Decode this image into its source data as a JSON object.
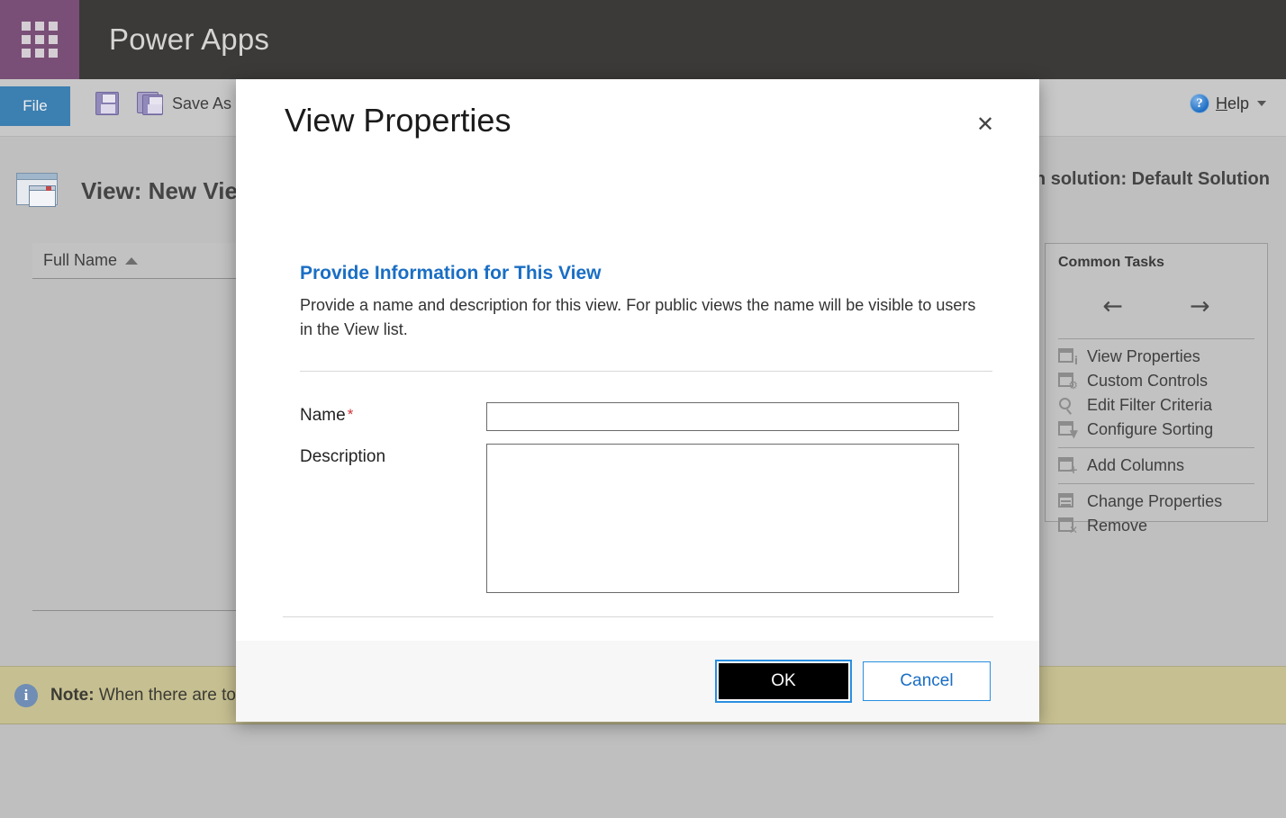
{
  "app_bar": {
    "waffle_icon": "app-launcher-waffle-icon",
    "title": "Power Apps"
  },
  "ribbon": {
    "file_tab": "File",
    "save_icon": "save-floppy-icon",
    "save_as_icon": "save-as-floppy-icon",
    "save_as_label": "Save As",
    "help": {
      "icon": "help-question-icon",
      "accesskey": "H",
      "label_rest": "elp",
      "caret": "chevron-down-icon"
    }
  },
  "page": {
    "view_icon": "view-window-icon",
    "view_title": "View: New Vie",
    "solution_label": "on solution: Default Solution",
    "grid": {
      "columns": [
        "Full Name"
      ],
      "sort_indicator": "sort-ascending-icon"
    }
  },
  "common_tasks": {
    "title": "Common Tasks",
    "nav": {
      "back": "←",
      "forward": "→"
    },
    "groups": [
      {
        "items": [
          {
            "label": "View Properties",
            "icon": "view-properties-icon",
            "mark": "i"
          },
          {
            "label": "Custom Controls",
            "icon": "custom-controls-icon",
            "mark": "⚙"
          },
          {
            "label": "Edit Filter Criteria",
            "icon": "magnifier-icon",
            "mark": ""
          },
          {
            "label": "Configure Sorting",
            "icon": "configure-sorting-icon",
            "mark": "▼"
          }
        ]
      },
      {
        "items": [
          {
            "label": "Add Columns",
            "icon": "add-columns-icon",
            "mark": "+"
          }
        ]
      },
      {
        "items": [
          {
            "label": "Change Properties",
            "icon": "change-properties-icon",
            "mark": "≡"
          },
          {
            "label": "Remove",
            "icon": "remove-icon",
            "mark": "✕"
          }
        ]
      }
    ]
  },
  "note_bar": {
    "icon": "info-icon",
    "prefix": "Note:",
    "text": "When there are to"
  },
  "dialog": {
    "title": "View Properties",
    "close_icon": "close-icon",
    "section_heading": "Provide Information for This View",
    "section_description": "Provide a name and description for this view. For public views the name will be visible to users in the View list.",
    "fields": {
      "name": {
        "label": "Name",
        "required_marker": "*",
        "value": "",
        "placeholder": ""
      },
      "description": {
        "label": "Description",
        "value": "",
        "placeholder": ""
      }
    },
    "buttons": {
      "ok": "OK",
      "cancel": "Cancel"
    }
  },
  "colors": {
    "brand_purple": "#7a4f77",
    "app_bar": "#3b3a39",
    "accent_blue": "#1a6ec4",
    "focus_blue": "#2a8fe0",
    "file_tab_blue": "#3c7fb1",
    "note_khaki": "#c6bf91",
    "required_red": "#d13438",
    "page_gray": "#bfbfbf"
  }
}
